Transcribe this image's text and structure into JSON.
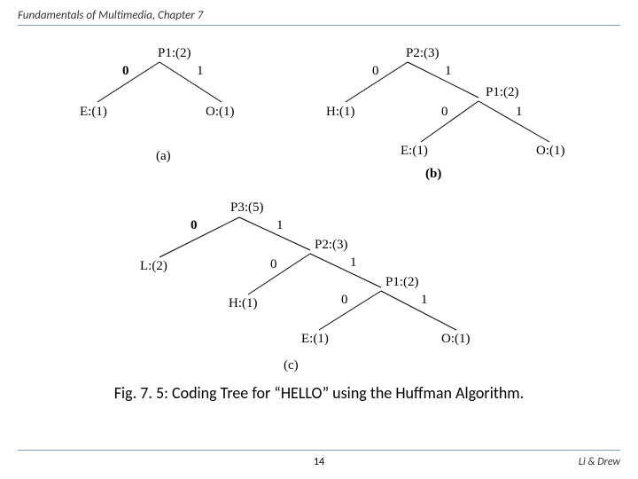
{
  "header": "Fundamentals of Multimedia, Chapter 7",
  "caption": "Fig. 7. 5: Coding Tree for “HELLO” using the Huffman Algorithm.",
  "page": "14",
  "authors": "Li & Drew",
  "trees": {
    "a": {
      "root": "P1:(2)",
      "zero": "0",
      "one": "1",
      "left": "E:(1)",
      "right": "O:(1)",
      "tag": "(a)"
    },
    "b": {
      "root": "P2:(3)",
      "zero": "0",
      "one": "1",
      "left": "H:(1)",
      "sub": {
        "root": "P1:(2)",
        "zero": "0",
        "one": "1",
        "left": "E:(1)",
        "right": "O:(1)"
      },
      "tag": "(b)"
    },
    "c": {
      "root": "P3:(5)",
      "zero": "0",
      "one": "1",
      "left": "L:(2)",
      "sub1": {
        "root": "P2:(3)",
        "zero": "0",
        "one": "1",
        "left": "H:(1)"
      },
      "sub2": {
        "root": "P1:(2)",
        "zero": "0",
        "one": "1",
        "left": "E:(1)",
        "right": "O:(1)"
      },
      "tag": "(c)"
    }
  }
}
